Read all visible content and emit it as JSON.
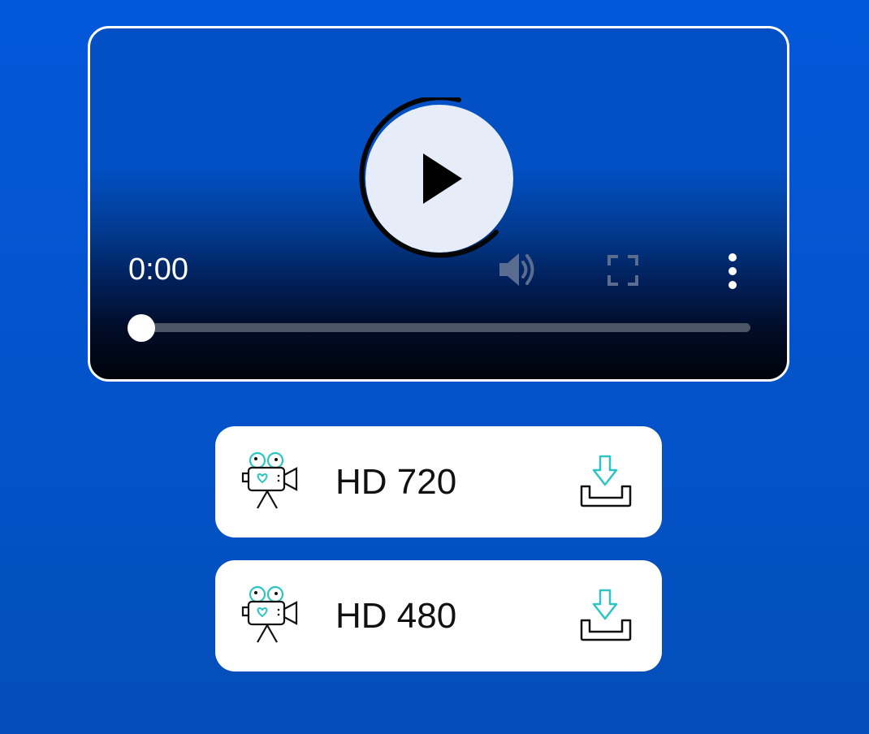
{
  "player": {
    "time": "0:00",
    "progress_fraction": 0,
    "play_icon": "play-icon",
    "volume_icon": "volume-icon",
    "fullscreen_icon": "fullscreen-icon",
    "menu_icon": "more-vertical-icon"
  },
  "options": [
    {
      "label": "HD 720",
      "icon": "video-camera-icon",
      "action_icon": "download-icon"
    },
    {
      "label": "HD 480",
      "icon": "video-camera-icon",
      "action_icon": "download-icon"
    }
  ],
  "colors": {
    "background": "#0358da",
    "card": "#ffffff",
    "accent_teal": "#2ec4c4",
    "play_button": "#e6ecf8"
  }
}
